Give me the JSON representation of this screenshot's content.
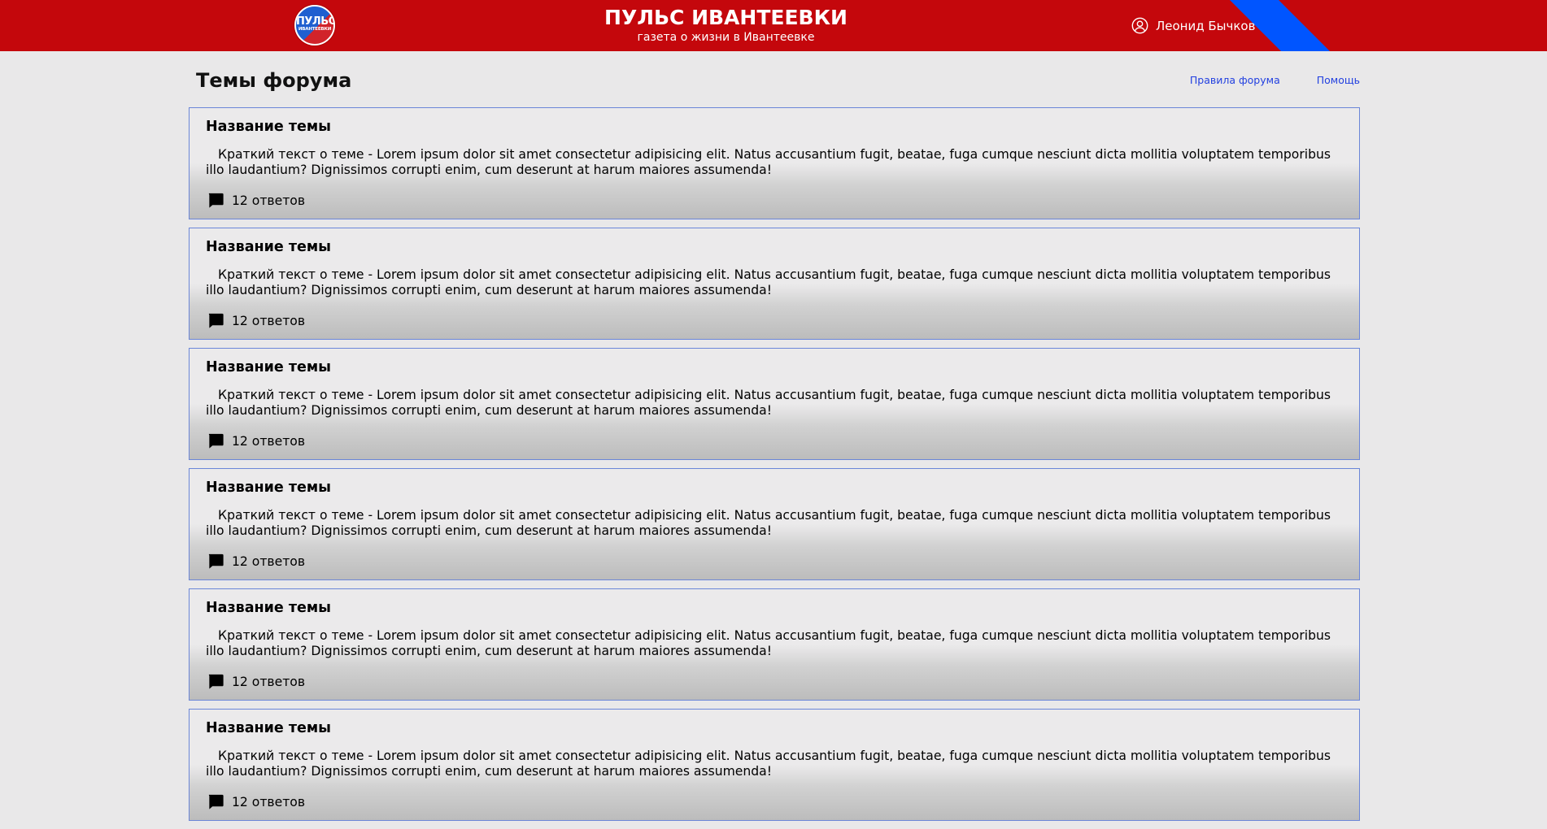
{
  "header": {
    "logo_line1": "ПУЛЬС",
    "logo_line2": "ИВАНТЕЕВКИ",
    "title": "ПУЛЬС ИВАНТЕЕВКИ",
    "subtitle": "газета о жизни в Ивантеевке",
    "user_name": "Леонид Бычков",
    "user_icon": "user-circle-icon",
    "colors": {
      "bar": "#c4070c",
      "stripe": "#0055ff"
    }
  },
  "page": {
    "title": "Темы форума",
    "links": [
      {
        "label": "Правила форума"
      },
      {
        "label": "Помощь"
      }
    ]
  },
  "topics": [
    {
      "title": "Название темы",
      "text": "Краткий текст о теме - Lorem ipsum dolor sit amet consectetur adipisicing elit. Natus accusantium fugit, beatae, fuga cumque nesciunt dicta mollitia voluptatem temporibus illo laudantium? Dignissimos corrupti enim, cum deserunt at harum maiores assumenda!",
      "replies": "12 ответов"
    },
    {
      "title": "Название темы",
      "text": "Краткий текст о теме - Lorem ipsum dolor sit amet consectetur adipisicing elit. Natus accusantium fugit, beatae, fuga cumque nesciunt dicta mollitia voluptatem temporibus illo laudantium? Dignissimos corrupti enim, cum deserunt at harum maiores assumenda!",
      "replies": "12 ответов"
    },
    {
      "title": "Название темы",
      "text": "Краткий текст о теме - Lorem ipsum dolor sit amet consectetur adipisicing elit. Natus accusantium fugit, beatae, fuga cumque nesciunt dicta mollitia voluptatem temporibus illo laudantium? Dignissimos corrupti enim, cum deserunt at harum maiores assumenda!",
      "replies": "12 ответов"
    },
    {
      "title": "Название темы",
      "text": "Краткий текст о теме - Lorem ipsum dolor sit amet consectetur adipisicing elit. Natus accusantium fugit, beatae, fuga cumque nesciunt dicta mollitia voluptatem temporibus illo laudantium? Dignissimos corrupti enim, cum deserunt at harum maiores assumenda!",
      "replies": "12 ответов"
    },
    {
      "title": "Название темы",
      "text": "Краткий текст о теме - Lorem ipsum dolor sit amet consectetur adipisicing elit. Natus accusantium fugit, beatae, fuga cumque nesciunt dicta mollitia voluptatem temporibus illo laudantium? Dignissimos corrupti enim, cum deserunt at harum maiores assumenda!",
      "replies": "12 ответов"
    },
    {
      "title": "Название темы",
      "text": "Краткий текст о теме - Lorem ipsum dolor sit amet consectetur adipisicing elit. Natus accusantium fugit, beatae, fuga cumque nesciunt dicta mollitia voluptatem temporibus illo laudantium? Dignissimos corrupti enim, cum deserunt at harum maiores assumenda!",
      "replies": "12 ответов"
    }
  ],
  "icons": {
    "reply": "comment-bubble-icon"
  }
}
